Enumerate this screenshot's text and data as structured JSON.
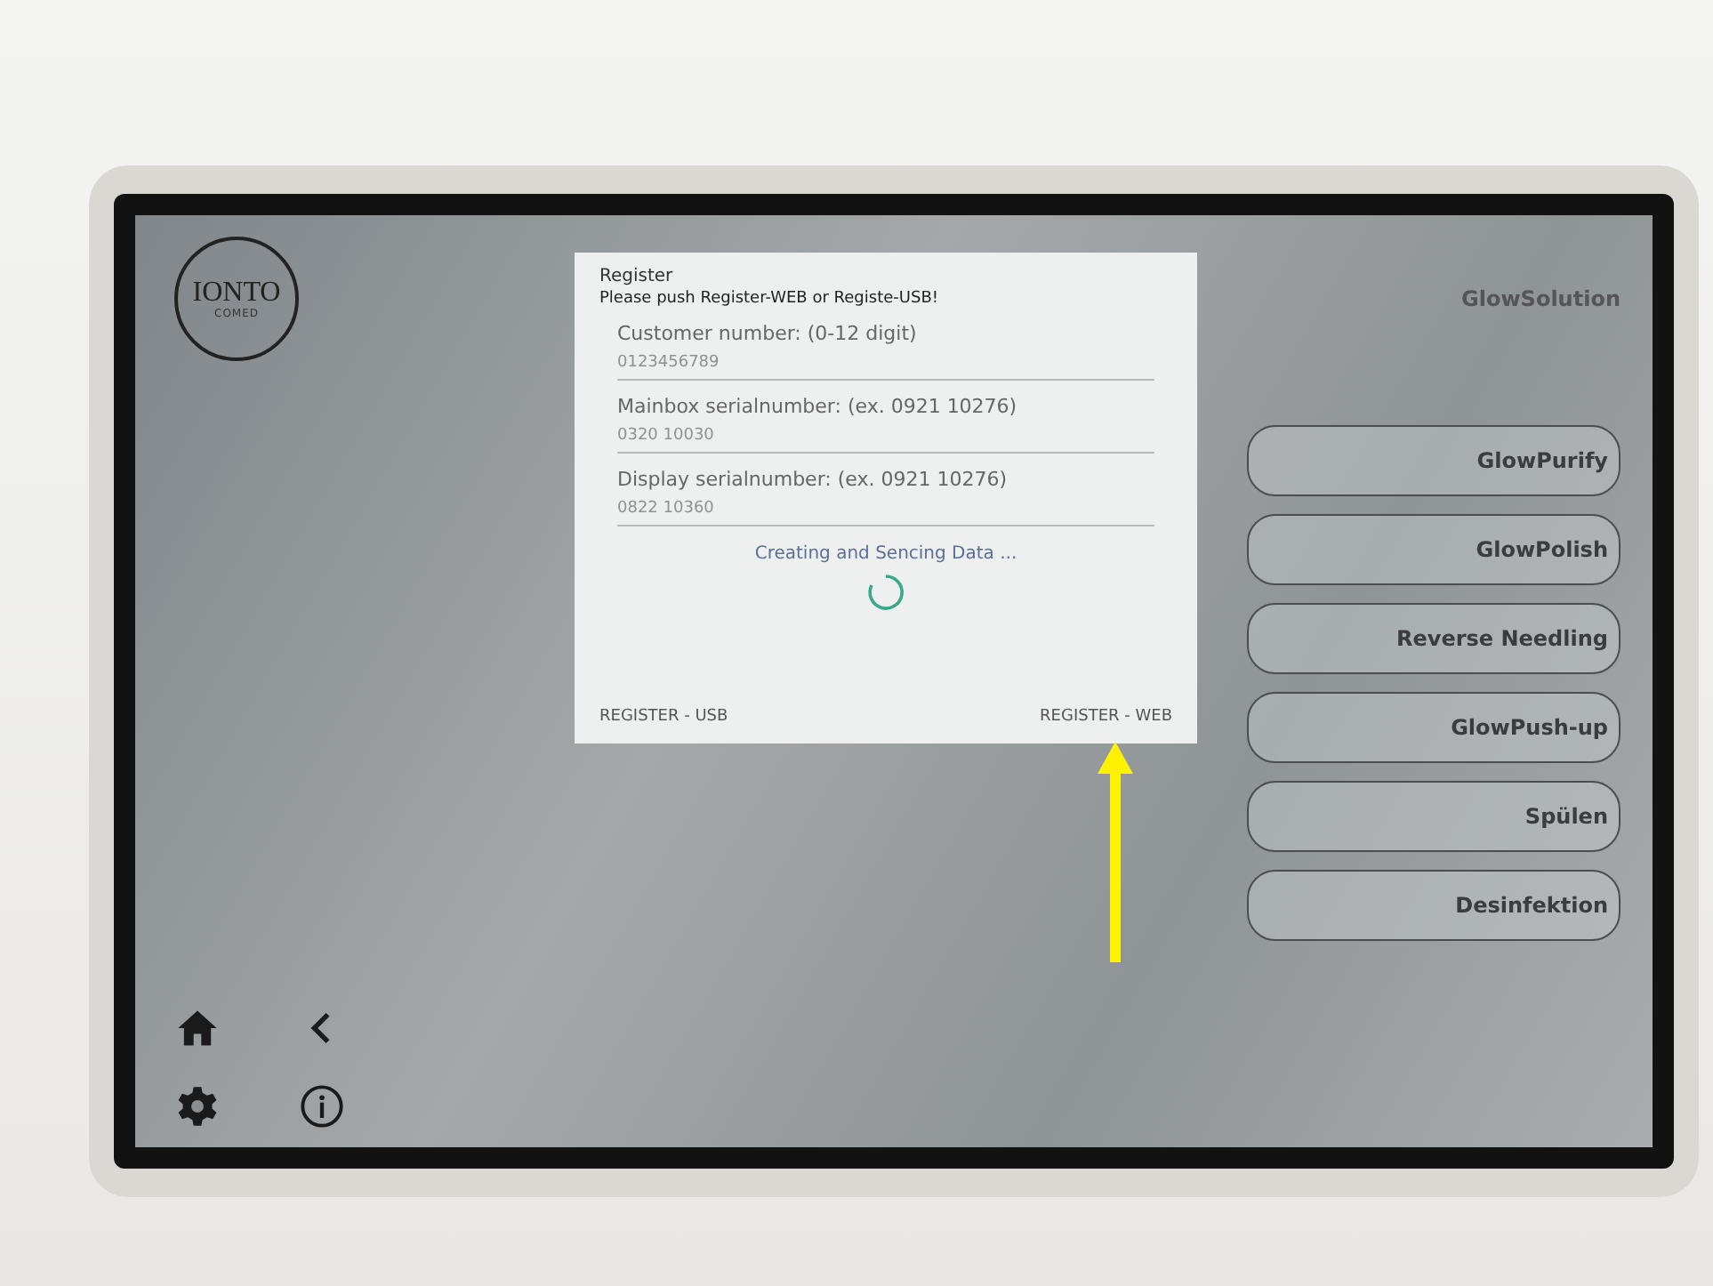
{
  "logo": {
    "name": "IONTO",
    "sub": "COMED"
  },
  "dialog": {
    "title": "Register",
    "instruction": "Please push Register-WEB or Registe-USB!",
    "fields": [
      {
        "label": "Customer number: (0-12 digit)",
        "placeholder": "0123456789"
      },
      {
        "label": "Mainbox serialnumber: (ex. 0921 10276)",
        "placeholder": "0320 10030"
      },
      {
        "label": "Display serialnumber: (ex. 0921 10276)",
        "placeholder": "0822 10360"
      }
    ],
    "status": "Creating and Sencing Data ...",
    "buttons": [
      "REGISTER - USB",
      "REGISTER - WEB"
    ]
  },
  "app_title": "GlowSolution",
  "programs": [
    "GlowPurify",
    "GlowPolish",
    "Reverse Needling",
    "GlowPush-up",
    "Spülen",
    "Desinfektion"
  ]
}
